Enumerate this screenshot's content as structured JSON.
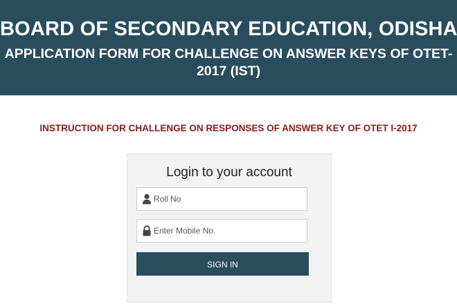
{
  "header": {
    "title": "BOARD OF SECONDARY EDUCATION, ODISHA",
    "subtitle": "APPLICATION FORM FOR CHALLENGE ON ANSWER KEYS OF OTET-2017 (IST)"
  },
  "instruction": {
    "text": "INSTRUCTION FOR CHALLENGE ON RESPONSES OF ANSWER KEY OF OTET I-2017"
  },
  "login": {
    "title": "Login to your account",
    "roll_field": {
      "icon": "user-icon",
      "placeholder": "Roll No",
      "value": ""
    },
    "mobile_field": {
      "icon": "lock-icon",
      "placeholder": "Enter Mobile No.",
      "value": ""
    },
    "signin_label": "SIGN IN"
  },
  "colors": {
    "header_bg": "#2a4d5e",
    "instruction_text": "#8b1a1a",
    "button_bg": "#2a4d5e",
    "login_box_bg": "#f2f2f2"
  }
}
